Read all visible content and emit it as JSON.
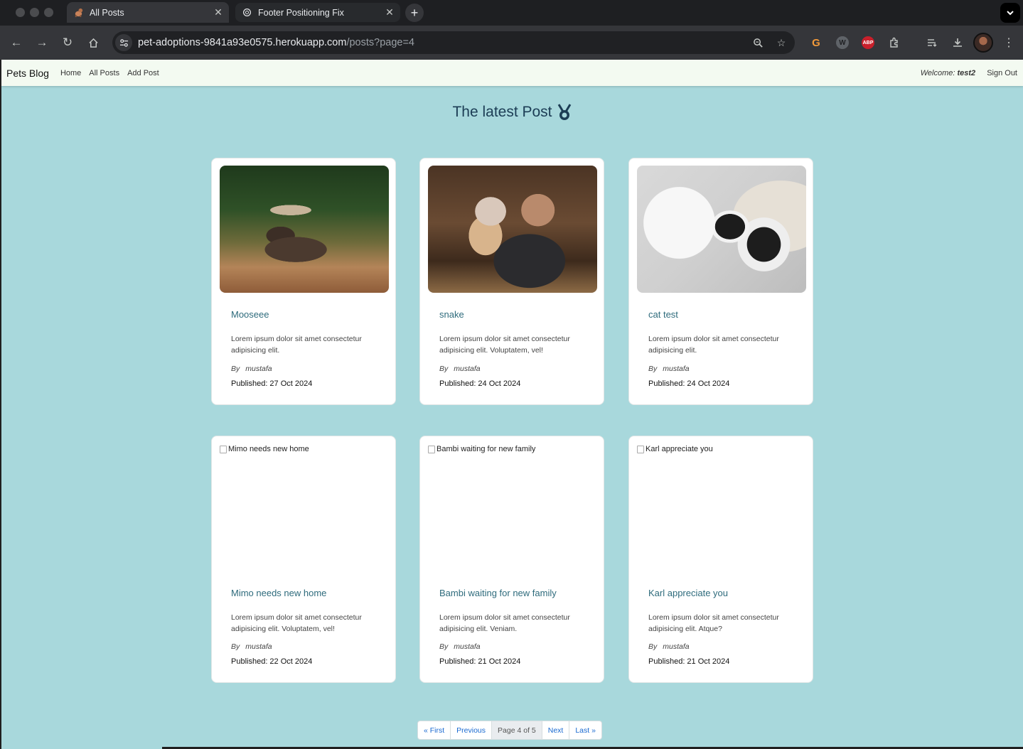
{
  "browser": {
    "tabs": [
      {
        "title": "All Posts",
        "icon": "dog-favicon-icon",
        "active": true
      },
      {
        "title": "Footer Positioning Fix",
        "icon": "chatgpt-favicon-icon",
        "active": false
      }
    ],
    "url_host": "pet-adoptions-9841a93e0575.herokuapp.com",
    "url_path": "/posts?page=4",
    "extensions": [
      "grammarly-icon",
      "w-extension-icon",
      "adblock-plus-icon",
      "puzzle-extensions-icon"
    ],
    "extension_labels": {
      "abp": "ABP",
      "w": "W",
      "g": "G"
    }
  },
  "navbar": {
    "brand": "Pets Blog",
    "links": [
      "Home",
      "All Posts",
      "Add Post"
    ],
    "welcome_label": "Welcome:",
    "username": "test2",
    "sign_out": "Sign Out"
  },
  "page": {
    "title": "The latest Post"
  },
  "posts": [
    {
      "title": "Mooseee",
      "excerpt": "Lorem ipsum dolor sit amet consectetur adipisicing elit.",
      "by": "By",
      "author": "mustafa",
      "published": "Published: 27 Oct 2024",
      "image": "moose",
      "image_alt": ""
    },
    {
      "title": "snake",
      "excerpt": "Lorem ipsum dolor sit amet consectetur adipisicing elit. Voluptatem, vel!",
      "by": "By",
      "author": "mustafa",
      "published": "Published: 24 Oct 2024",
      "image": "couple-with-dog",
      "image_alt": ""
    },
    {
      "title": "cat test",
      "excerpt": "Lorem ipsum dolor sit amet consectetur adipisicing elit.",
      "by": "By",
      "author": "mustafa",
      "published": "Published: 24 Oct 2024",
      "image": "dog-and-cats",
      "image_alt": ""
    },
    {
      "title": "Mimo needs new home",
      "excerpt": "Lorem ipsum dolor sit amet consectetur adipisicing elit. Voluptatem, vel!",
      "by": "By",
      "author": "mustafa",
      "published": "Published: 22 Oct 2024",
      "image": "",
      "image_alt": "Mimo needs new home"
    },
    {
      "title": "Bambi waiting for new family",
      "excerpt": "Lorem ipsum dolor sit amet consectetur adipisicing elit. Veniam.",
      "by": "By",
      "author": "mustafa",
      "published": "Published: 21 Oct 2024",
      "image": "",
      "image_alt": "Bambi waiting for new family"
    },
    {
      "title": "Karl appreciate you",
      "excerpt": "Lorem ipsum dolor sit amet consectetur adipisicing elit. Atque?",
      "by": "By",
      "author": "mustafa",
      "published": "Published: 21 Oct 2024",
      "image": "",
      "image_alt": "Karl appreciate you"
    }
  ],
  "pagination": {
    "first": "« First",
    "previous": "Previous",
    "current": "Page 4 of 5",
    "next": "Next",
    "last": "Last »"
  },
  "colors": {
    "page_bg": "#a8d8dc",
    "navbar_bg": "#f3faf1",
    "title_color": "#1c3d55",
    "post_title_color": "#2e6b7c",
    "link_color": "#1a6ad1"
  }
}
